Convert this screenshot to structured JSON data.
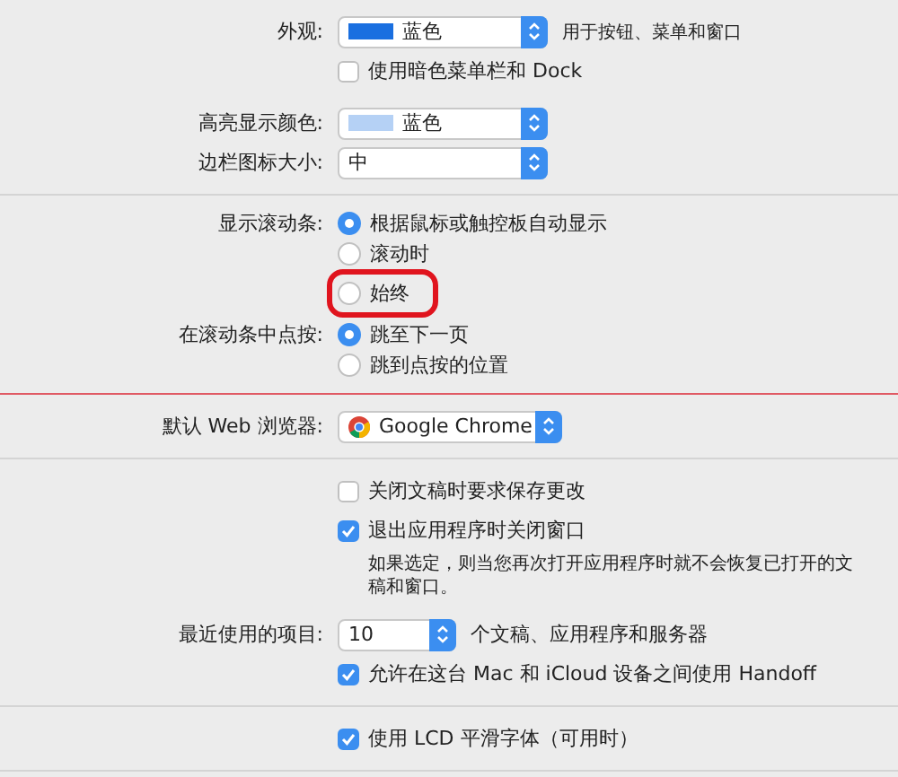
{
  "sections": [
    {
      "marked": false,
      "rows": [
        {
          "kind": "popup",
          "label": "外观:",
          "value": "蓝色",
          "color": "#1a6fe0",
          "suffix": "用于按钮、菜单和窗口"
        },
        {
          "kind": "checkbox",
          "text": "使用暗色菜单栏和 Dock",
          "checked": false
        },
        {
          "kind": "gap"
        },
        {
          "kind": "popup",
          "label": "高亮显示颜色:",
          "value": "蓝色",
          "color": "#b5d1f5"
        },
        {
          "kind": "popup",
          "label": "边栏图标大小:",
          "value": "中"
        }
      ]
    },
    {
      "marked": true,
      "rows": [
        {
          "kind": "radios",
          "label": "显示滚动条:",
          "options": [
            {
              "text": "根据鼠标或触控板自动显示",
              "selected": true,
              "highlighted": false
            },
            {
              "text": "滚动时",
              "selected": false,
              "highlighted": false
            },
            {
              "text": "始终",
              "selected": false,
              "highlighted": true
            }
          ]
        },
        {
          "kind": "radios",
          "label": "在滚动条中点按:",
          "options": [
            {
              "text": "跳至下一页",
              "selected": true,
              "highlighted": false
            },
            {
              "text": "跳到点按的位置",
              "selected": false,
              "highlighted": false
            }
          ]
        }
      ]
    },
    {
      "marked": false,
      "rows": [
        {
          "kind": "browser_popup",
          "label": "默认 Web 浏览器:",
          "value": "Google Chrome"
        }
      ]
    },
    {
      "marked": false,
      "rows": [
        {
          "kind": "checkbox",
          "text": "关闭文稿时要求保存更改",
          "checked": false
        },
        {
          "kind": "checkbox",
          "text": "退出应用程序时关闭窗口",
          "checked": true
        },
        {
          "kind": "note",
          "text": "如果选定，则当您再次打开应用程序时就不会恢复已打开的文稿和窗口。"
        },
        {
          "kind": "gap"
        },
        {
          "kind": "short_popup",
          "label": "最近使用的项目:",
          "value": "10",
          "suffix": "个文稿、应用程序和服务器"
        },
        {
          "kind": "checkbox",
          "text": "允许在这台 Mac 和 iCloud 设备之间使用 Handoff",
          "checked": true
        }
      ]
    },
    {
      "marked": false,
      "rows": [
        {
          "kind": "checkbox",
          "text": "使用 LCD 平滑字体（可用时）",
          "checked": true
        }
      ]
    }
  ]
}
